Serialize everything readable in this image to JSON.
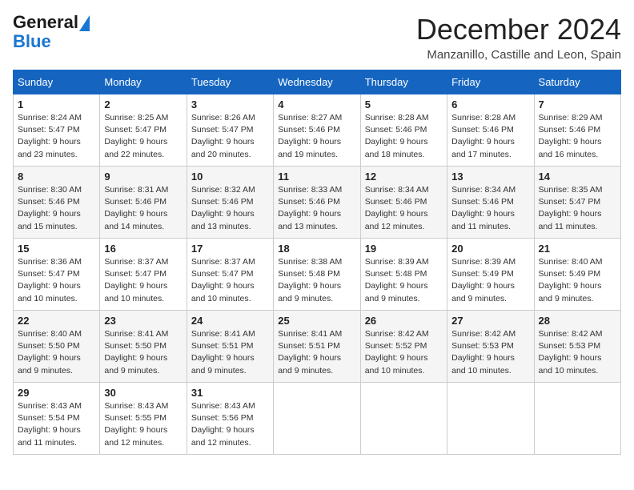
{
  "header": {
    "logo_line1": "General",
    "logo_line2": "Blue",
    "month": "December 2024",
    "location": "Manzanillo, Castille and Leon, Spain"
  },
  "weekdays": [
    "Sunday",
    "Monday",
    "Tuesday",
    "Wednesday",
    "Thursday",
    "Friday",
    "Saturday"
  ],
  "weeks": [
    [
      {
        "day": "1",
        "sunrise": "8:24 AM",
        "sunset": "5:47 PM",
        "daylight": "9 hours and 23 minutes."
      },
      {
        "day": "2",
        "sunrise": "8:25 AM",
        "sunset": "5:47 PM",
        "daylight": "9 hours and 22 minutes."
      },
      {
        "day": "3",
        "sunrise": "8:26 AM",
        "sunset": "5:47 PM",
        "daylight": "9 hours and 20 minutes."
      },
      {
        "day": "4",
        "sunrise": "8:27 AM",
        "sunset": "5:46 PM",
        "daylight": "9 hours and 19 minutes."
      },
      {
        "day": "5",
        "sunrise": "8:28 AM",
        "sunset": "5:46 PM",
        "daylight": "9 hours and 18 minutes."
      },
      {
        "day": "6",
        "sunrise": "8:28 AM",
        "sunset": "5:46 PM",
        "daylight": "9 hours and 17 minutes."
      },
      {
        "day": "7",
        "sunrise": "8:29 AM",
        "sunset": "5:46 PM",
        "daylight": "9 hours and 16 minutes."
      }
    ],
    [
      {
        "day": "8",
        "sunrise": "8:30 AM",
        "sunset": "5:46 PM",
        "daylight": "9 hours and 15 minutes."
      },
      {
        "day": "9",
        "sunrise": "8:31 AM",
        "sunset": "5:46 PM",
        "daylight": "9 hours and 14 minutes."
      },
      {
        "day": "10",
        "sunrise": "8:32 AM",
        "sunset": "5:46 PM",
        "daylight": "9 hours and 13 minutes."
      },
      {
        "day": "11",
        "sunrise": "8:33 AM",
        "sunset": "5:46 PM",
        "daylight": "9 hours and 13 minutes."
      },
      {
        "day": "12",
        "sunrise": "8:34 AM",
        "sunset": "5:46 PM",
        "daylight": "9 hours and 12 minutes."
      },
      {
        "day": "13",
        "sunrise": "8:34 AM",
        "sunset": "5:46 PM",
        "daylight": "9 hours and 11 minutes."
      },
      {
        "day": "14",
        "sunrise": "8:35 AM",
        "sunset": "5:47 PM",
        "daylight": "9 hours and 11 minutes."
      }
    ],
    [
      {
        "day": "15",
        "sunrise": "8:36 AM",
        "sunset": "5:47 PM",
        "daylight": "9 hours and 10 minutes."
      },
      {
        "day": "16",
        "sunrise": "8:37 AM",
        "sunset": "5:47 PM",
        "daylight": "9 hours and 10 minutes."
      },
      {
        "day": "17",
        "sunrise": "8:37 AM",
        "sunset": "5:47 PM",
        "daylight": "9 hours and 10 minutes."
      },
      {
        "day": "18",
        "sunrise": "8:38 AM",
        "sunset": "5:48 PM",
        "daylight": "9 hours and 9 minutes."
      },
      {
        "day": "19",
        "sunrise": "8:39 AM",
        "sunset": "5:48 PM",
        "daylight": "9 hours and 9 minutes."
      },
      {
        "day": "20",
        "sunrise": "8:39 AM",
        "sunset": "5:49 PM",
        "daylight": "9 hours and 9 minutes."
      },
      {
        "day": "21",
        "sunrise": "8:40 AM",
        "sunset": "5:49 PM",
        "daylight": "9 hours and 9 minutes."
      }
    ],
    [
      {
        "day": "22",
        "sunrise": "8:40 AM",
        "sunset": "5:50 PM",
        "daylight": "9 hours and 9 minutes."
      },
      {
        "day": "23",
        "sunrise": "8:41 AM",
        "sunset": "5:50 PM",
        "daylight": "9 hours and 9 minutes."
      },
      {
        "day": "24",
        "sunrise": "8:41 AM",
        "sunset": "5:51 PM",
        "daylight": "9 hours and 9 minutes."
      },
      {
        "day": "25",
        "sunrise": "8:41 AM",
        "sunset": "5:51 PM",
        "daylight": "9 hours and 9 minutes."
      },
      {
        "day": "26",
        "sunrise": "8:42 AM",
        "sunset": "5:52 PM",
        "daylight": "9 hours and 10 minutes."
      },
      {
        "day": "27",
        "sunrise": "8:42 AM",
        "sunset": "5:53 PM",
        "daylight": "9 hours and 10 minutes."
      },
      {
        "day": "28",
        "sunrise": "8:42 AM",
        "sunset": "5:53 PM",
        "daylight": "9 hours and 10 minutes."
      }
    ],
    [
      {
        "day": "29",
        "sunrise": "8:43 AM",
        "sunset": "5:54 PM",
        "daylight": "9 hours and 11 minutes."
      },
      {
        "day": "30",
        "sunrise": "8:43 AM",
        "sunset": "5:55 PM",
        "daylight": "9 hours and 12 minutes."
      },
      {
        "day": "31",
        "sunrise": "8:43 AM",
        "sunset": "5:56 PM",
        "daylight": "9 hours and 12 minutes."
      },
      null,
      null,
      null,
      null
    ]
  ]
}
